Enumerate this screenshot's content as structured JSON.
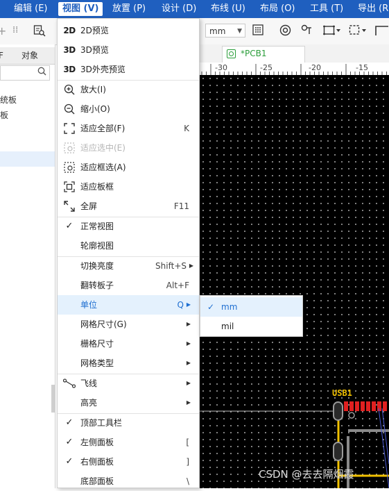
{
  "menubar": {
    "items": [
      {
        "label": "编辑 (E)"
      },
      {
        "label": "视图 (V)"
      },
      {
        "label": "放置 (P)"
      },
      {
        "label": "设计 (D)"
      },
      {
        "label": "布线 (U)"
      },
      {
        "label": "布局 (O)"
      },
      {
        "label": "工具 (T)"
      },
      {
        "label": "导出 (R"
      }
    ]
  },
  "toolbar": {
    "unit_value": "mm"
  },
  "left_panel": {
    "tab_partial": "F",
    "tab_objects": "对象",
    "item1": "统板",
    "item2": "板"
  },
  "document_tab": {
    "label": "*PCB1"
  },
  "ruler": {
    "ticks": [
      "-30",
      "-25",
      "-20",
      "-15"
    ]
  },
  "view_menu": {
    "items": [
      {
        "icon": "2D",
        "label": "2D预览",
        "shortcut": ""
      },
      {
        "icon": "3D",
        "label": "3D预览",
        "shortcut": ""
      },
      {
        "icon": "3D",
        "label": "3D外壳预览",
        "shortcut": ""
      },
      {
        "icon": "zoom-in-icon",
        "label": "放大(I)",
        "shortcut": ""
      },
      {
        "icon": "zoom-out-icon",
        "label": "缩小(O)",
        "shortcut": ""
      },
      {
        "icon": "fit-all-icon",
        "label": "适应全部(F)",
        "shortcut": "K"
      },
      {
        "icon": "fit-selection-icon",
        "label": "适应选中(E)",
        "shortcut": "",
        "disabled": true
      },
      {
        "icon": "fit-box-icon",
        "label": "适应框选(A)",
        "shortcut": ""
      },
      {
        "icon": "fit-board-icon",
        "label": "适应板框",
        "shortcut": ""
      },
      {
        "icon": "fullscreen-icon",
        "label": "全屏",
        "shortcut": "F11"
      },
      {
        "icon": "check-icon",
        "label": "正常视图",
        "shortcut": ""
      },
      {
        "icon": "",
        "label": "轮廓视图",
        "shortcut": ""
      },
      {
        "icon": "",
        "label": "切换亮度",
        "shortcut": "Shift+S",
        "submenu": true
      },
      {
        "icon": "",
        "label": "翻转板子",
        "shortcut": "Alt+F"
      },
      {
        "icon": "",
        "label": "单位",
        "shortcut": "Q",
        "submenu": true,
        "highlighted": true
      },
      {
        "icon": "",
        "label": "网格尺寸(G)",
        "shortcut": "",
        "submenu": true
      },
      {
        "icon": "",
        "label": "栅格尺寸",
        "shortcut": "",
        "submenu": true
      },
      {
        "icon": "",
        "label": "网格类型",
        "shortcut": "",
        "submenu": true
      },
      {
        "icon": "ratline-icon",
        "label": "飞线",
        "shortcut": "",
        "submenu": true
      },
      {
        "icon": "",
        "label": "高亮",
        "shortcut": "",
        "submenu": true
      },
      {
        "icon": "check-icon",
        "label": "顶部工具栏",
        "shortcut": ""
      },
      {
        "icon": "check-icon",
        "label": "左侧面板",
        "shortcut": "["
      },
      {
        "icon": "check-icon",
        "label": "右侧面板",
        "shortcut": "]"
      },
      {
        "icon": "",
        "label": "底部面板",
        "shortcut": "\\"
      }
    ]
  },
  "unit_submenu": {
    "items": [
      {
        "label": "mm",
        "checked": true
      },
      {
        "label": "mil",
        "checked": false
      }
    ]
  },
  "canvas": {
    "component_label": "USB1"
  },
  "watermark": "CSDN @去去隔烟霞",
  "colors": {
    "menubar": "#1f5fbf",
    "highlight": "#e4f1fd",
    "accent": "#1f6fd1",
    "canvas_bg": "#000000",
    "pcb_label": "#f0c000",
    "pad_red": "#e02020",
    "outline_yellow": "#f0c000"
  }
}
